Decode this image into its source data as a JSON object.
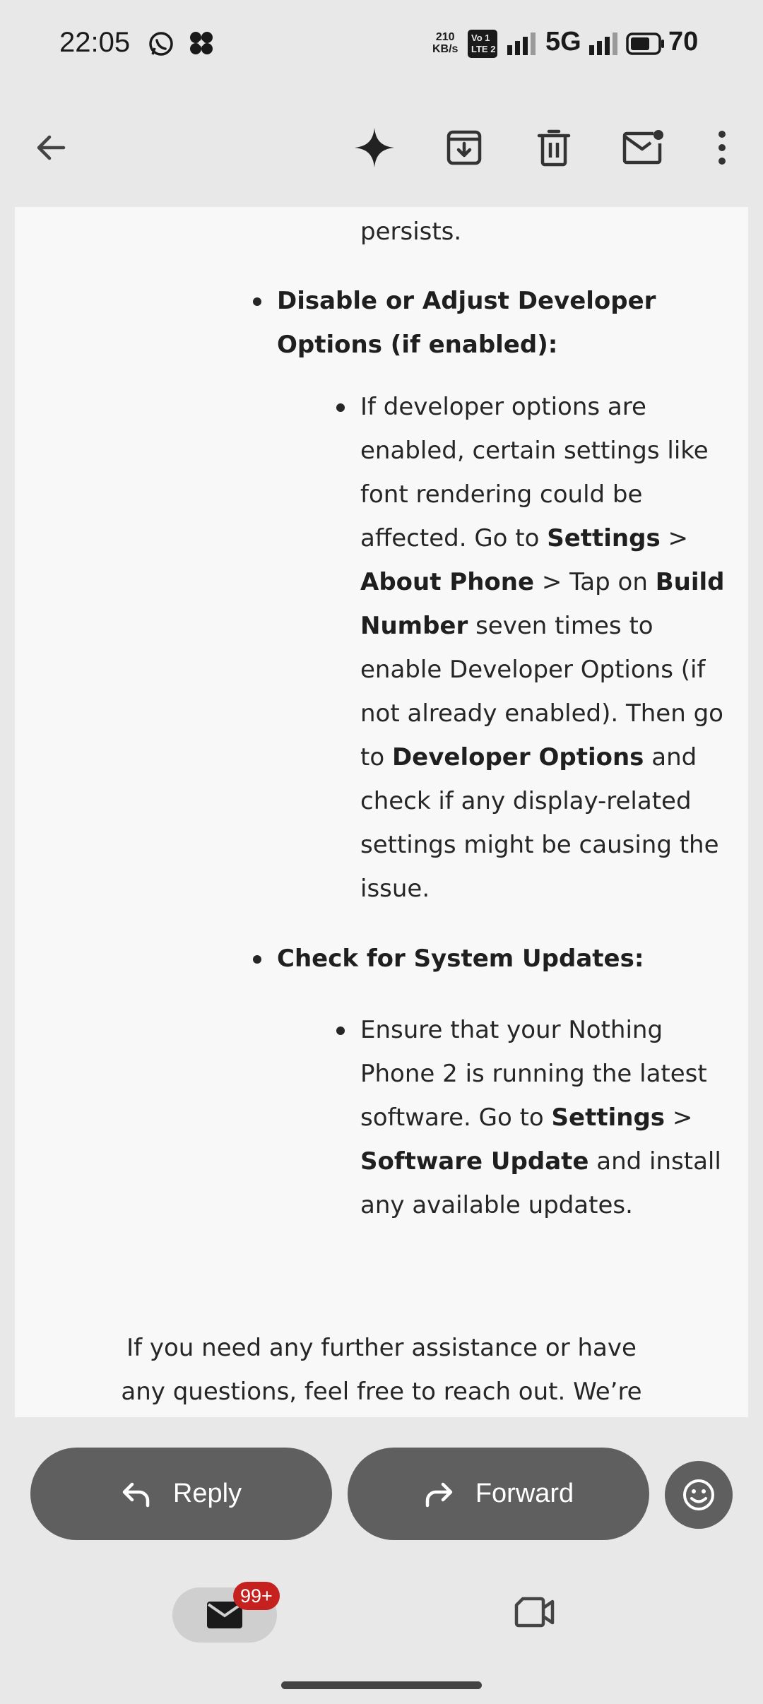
{
  "status_bar": {
    "time": "22:05",
    "speed_value": "210",
    "speed_unit": "KB/s",
    "volte_line1": "Vo 1",
    "volte_line2": "LTE 2",
    "network": "5G",
    "battery": "70"
  },
  "toolbar": {
    "icons": [
      "back-arrow-icon",
      "gemini-sparkle-icon",
      "archive-icon",
      "delete-icon",
      "mark-unread-icon",
      "more-vert-icon"
    ]
  },
  "email_body": {
    "line_persists": "persists.",
    "dev_heading_1": "Disable or Adjust Developer",
    "dev_heading_2": "Options (if enabled):",
    "dev_l1": "If developer options are",
    "dev_l2": "enabled, certain settings like",
    "dev_l3": "font rendering could be",
    "dev_l4a": "affected. Go to ",
    "dev_l4b": "Settings",
    "dev_l4c": " >",
    "dev_l5a": "About Phone",
    "dev_l5b": " > Tap on ",
    "dev_l5c": "Build",
    "dev_l6a": "Number",
    "dev_l6b": " seven times to",
    "dev_l7": "enable Developer Options (if",
    "dev_l8": "not already enabled). Then go",
    "dev_l9a": "to ",
    "dev_l9b": "Developer Options",
    "dev_l9c": " and",
    "dev_l10": "check if any display-related",
    "dev_l11": "settings might be causing the",
    "dev_l12": "issue.",
    "upd_heading": "Check for System Updates:",
    "upd_l1": "Ensure that your Nothing",
    "upd_l2": "Phone 2 is running the latest",
    "upd_l3a": "software. Go to ",
    "upd_l3b": "Settings",
    "upd_l3c": " >",
    "upd_l4a": "Software Update",
    "upd_l4b": " and install",
    "upd_l5": "any available updates.",
    "closing_1": "If you need any further assistance or have",
    "closing_2": "any questions, feel free to reach out. We’re"
  },
  "actions": {
    "reply_label": "Reply",
    "forward_label": "Forward"
  },
  "bottom_nav": {
    "mail_badge": "99+"
  },
  "colors": {
    "background": "#e8e8e8",
    "content_bg": "#f8f8f8",
    "pill": "#5f5f5f",
    "badge": "#c5221f"
  }
}
